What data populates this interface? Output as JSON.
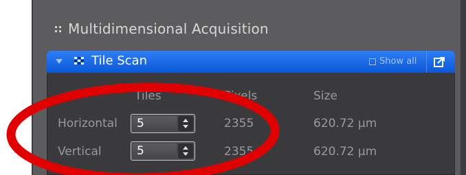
{
  "app": {
    "title": "Multidimensional Acquisition"
  },
  "panel": {
    "title": "Tile Scan",
    "show_all_label": "Show all",
    "header_color": "#1b6ae8"
  },
  "table": {
    "columns": {
      "tiles": "Tiles",
      "pixels": "Pixels",
      "size": "Size"
    },
    "rows": [
      {
        "label": "Horizontal",
        "tiles": "5",
        "pixels": "2355",
        "size": "620.72 µm"
      },
      {
        "label": "Vertical",
        "tiles": "5",
        "pixels": "2355",
        "size": "620.72 µm"
      }
    ]
  },
  "annotation": {
    "color": "#e00000"
  },
  "icons": [
    "grip-icon",
    "collapse-arrow-icon",
    "tile-grid-icon",
    "popout-icon",
    "spin-up-icon",
    "spin-down-icon"
  ]
}
